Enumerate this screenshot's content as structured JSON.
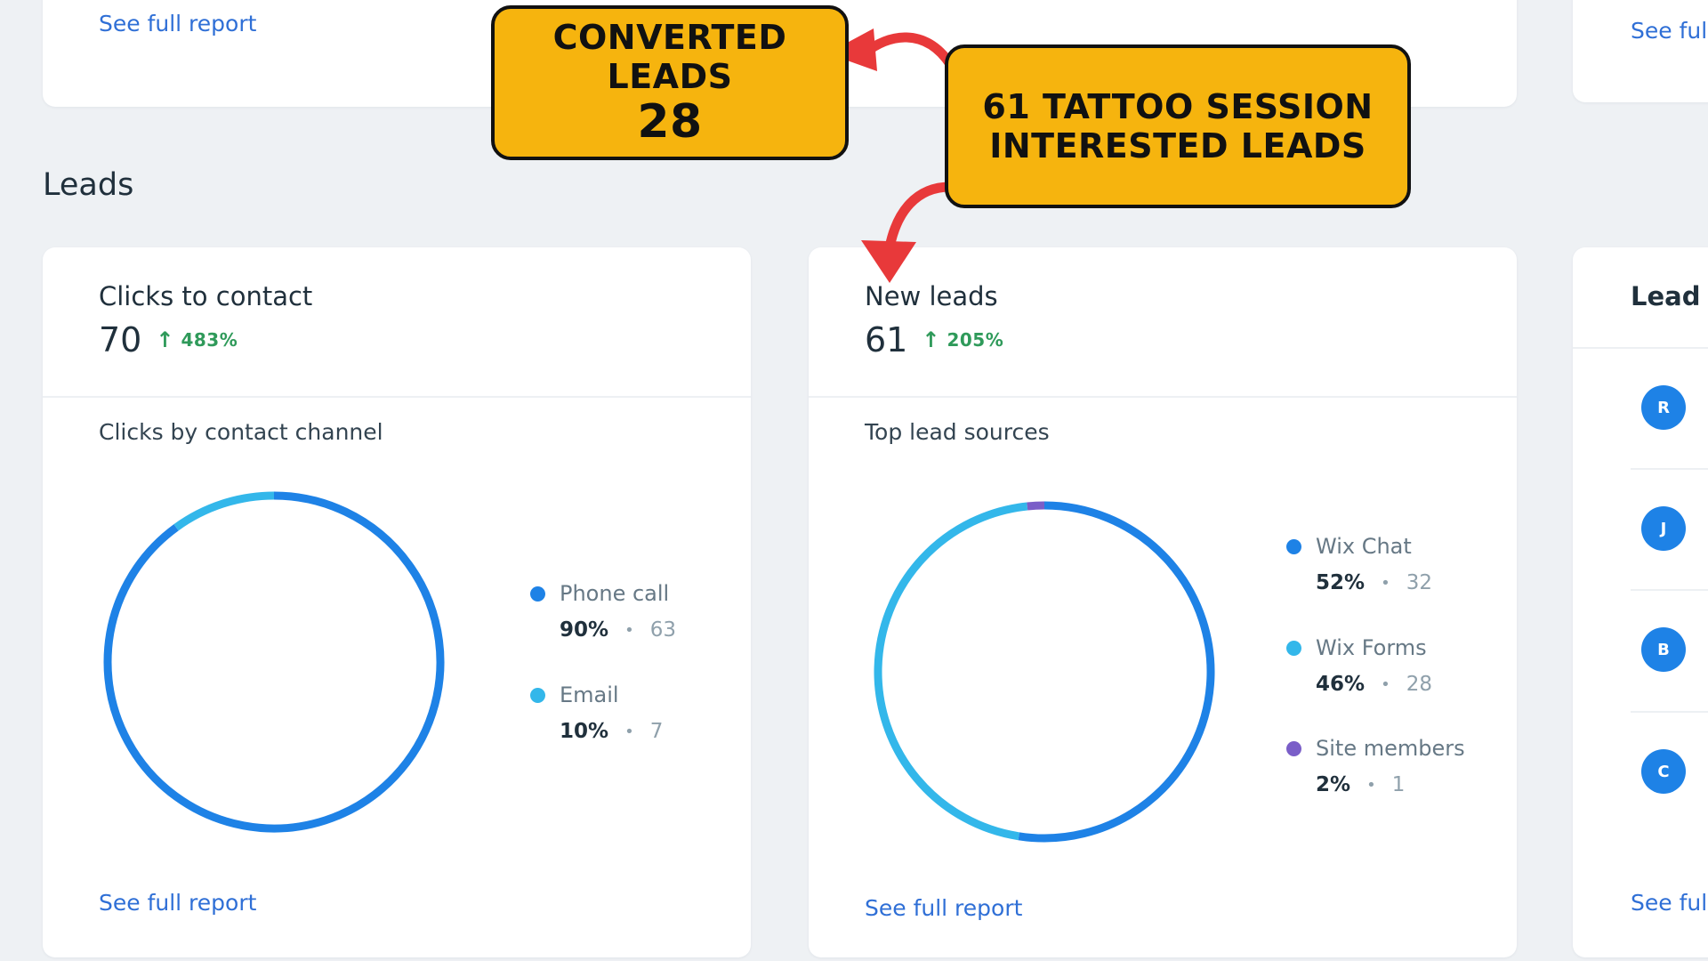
{
  "top_section": {
    "left_link": "See full report",
    "right_link": "See full"
  },
  "section_title": "Leads",
  "clicks_card": {
    "title": "Clicks to contact",
    "value": "70",
    "delta": "483%",
    "subtitle": "Clicks by contact channel",
    "link": "See full report",
    "legend": [
      {
        "name": "Phone call",
        "percent": "90%",
        "count": "63",
        "color": "#1e82e6"
      },
      {
        "name": "Email",
        "percent": "10%",
        "count": "7",
        "color": "#33b7ea"
      }
    ]
  },
  "leads_card": {
    "title": "New leads",
    "value": "61",
    "delta": "205%",
    "subtitle": "Top lead sources",
    "link": "See full report",
    "legend": [
      {
        "name": "Wix Chat",
        "percent": "52%",
        "count": "32",
        "color": "#1e82e6"
      },
      {
        "name": "Wix Forms",
        "percent": "46%",
        "count": "28",
        "color": "#33b7ea"
      },
      {
        "name": "Site members",
        "percent": "2%",
        "count": "1",
        "color": "#7a5ec8"
      }
    ]
  },
  "lead_inbox_card": {
    "title": "Lead i",
    "avatars": [
      "R",
      "J",
      "B",
      "C"
    ],
    "link": "See full"
  },
  "callouts": {
    "converted": {
      "line1": "CONVERTED",
      "line2": "LEADS",
      "value": "28",
      "color": "#f6b40e"
    },
    "interested": {
      "line1": "61 TATTOO SESSION",
      "line2": "INTERESTED LEADS",
      "color": "#f6b40e"
    },
    "arrow_color": "#e8393a"
  },
  "chart_data": [
    {
      "type": "pie",
      "title": "Clicks by contact channel",
      "categories": [
        "Phone call",
        "Email"
      ],
      "values": [
        63,
        7
      ],
      "colors": [
        "#1e82e6",
        "#33b7ea"
      ]
    },
    {
      "type": "pie",
      "title": "Top lead sources",
      "categories": [
        "Wix Chat",
        "Wix Forms",
        "Site members"
      ],
      "values": [
        32,
        28,
        1
      ],
      "colors": [
        "#1e82e6",
        "#33b7ea",
        "#7a5ec8"
      ]
    }
  ]
}
